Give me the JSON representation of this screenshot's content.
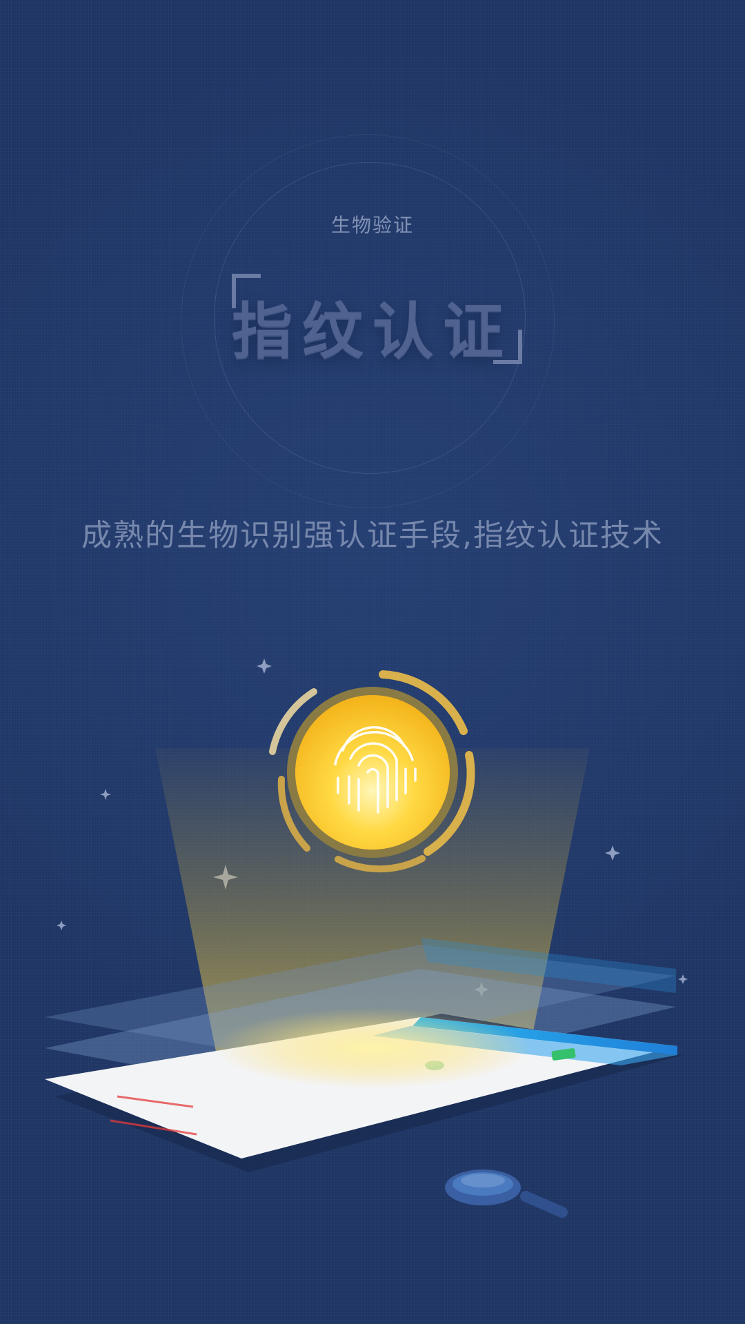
{
  "header": {
    "subtitle": "生物验证",
    "title": "指纹认证"
  },
  "tagline": "成熟的生物识别强认证手段,指纹认证技术",
  "illustration": {
    "main_icon": "fingerprint-icon",
    "secondary_icon": "magnifier-icon",
    "colors": {
      "background": "#1f3665",
      "accent_gold": "#f7c531",
      "accent_blue": "#2aa3e8"
    }
  }
}
